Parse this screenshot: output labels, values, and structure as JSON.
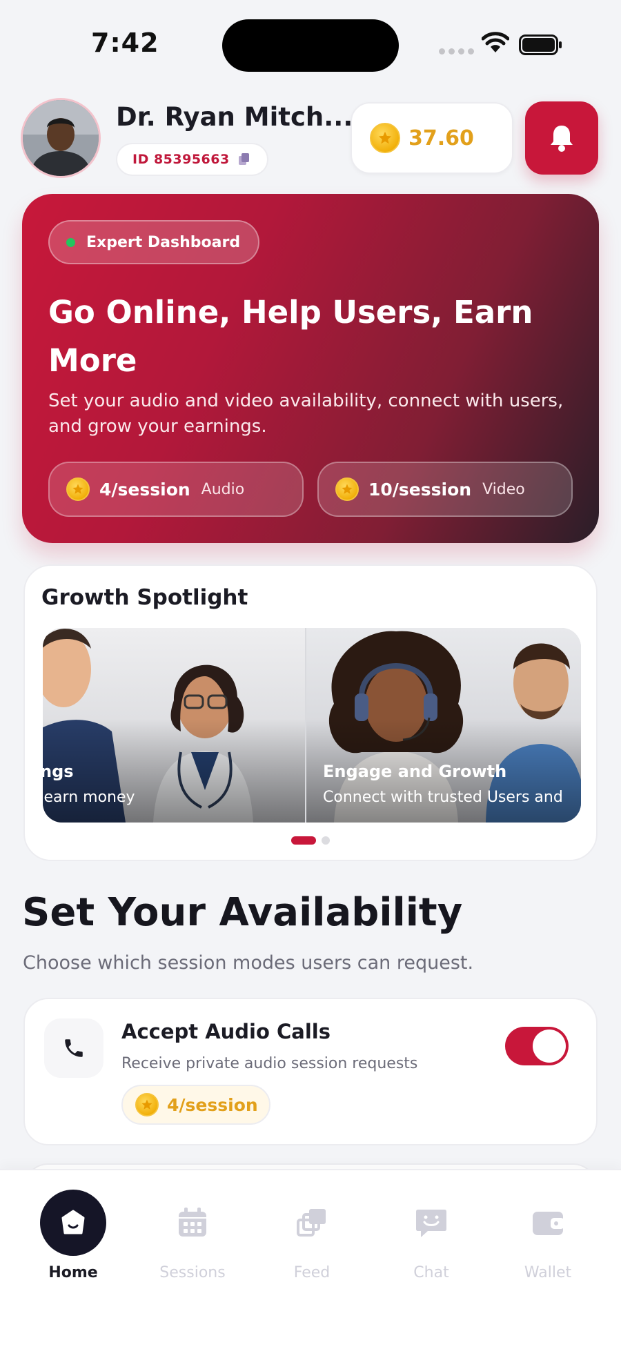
{
  "status_bar": {
    "time": "7:42"
  },
  "header": {
    "user_name": "Dr. Ryan Mitch...",
    "user_id": "ID 85395663",
    "coin_balance": "37.60"
  },
  "hero": {
    "badge": "Expert Dashboard",
    "title": "Go Online, Help Users, Earn More",
    "subtitle": "Set your audio and video availability, connect with users, and grow your earnings.",
    "rates": [
      {
        "value": "4/session",
        "type": "Audio"
      },
      {
        "value": "10/session",
        "type": "Video"
      }
    ]
  },
  "spotlight": {
    "title": "Growth Spotlight",
    "slides": [
      {
        "title": "ngs",
        "text": "e, earn money"
      },
      {
        "title": "Engage and Growth",
        "text": "Connect with trusted Users and"
      }
    ],
    "active_index": 0,
    "total": 2
  },
  "availability": {
    "title": "Set Your Availability",
    "subtitle": "Choose which session modes users can request.",
    "audio": {
      "title": "Accept Audio Calls",
      "description": "Receive private audio session requests",
      "rate": "4/session",
      "enabled": true
    }
  },
  "nav": {
    "items": [
      {
        "label": "Home",
        "icon": "home-icon",
        "active": true
      },
      {
        "label": "Sessions",
        "icon": "calendar-icon",
        "active": false
      },
      {
        "label": "Feed",
        "icon": "feed-icon",
        "active": false
      },
      {
        "label": "Chat",
        "icon": "chat-icon",
        "active": false
      },
      {
        "label": "Wallet",
        "icon": "wallet-icon",
        "active": false
      }
    ]
  },
  "colors": {
    "brand": "#c8173a",
    "coin": "#e2a01b",
    "nav_active": "#151527",
    "nav_inactive": "#d0d0da",
    "online_dot": "#22c55e"
  }
}
